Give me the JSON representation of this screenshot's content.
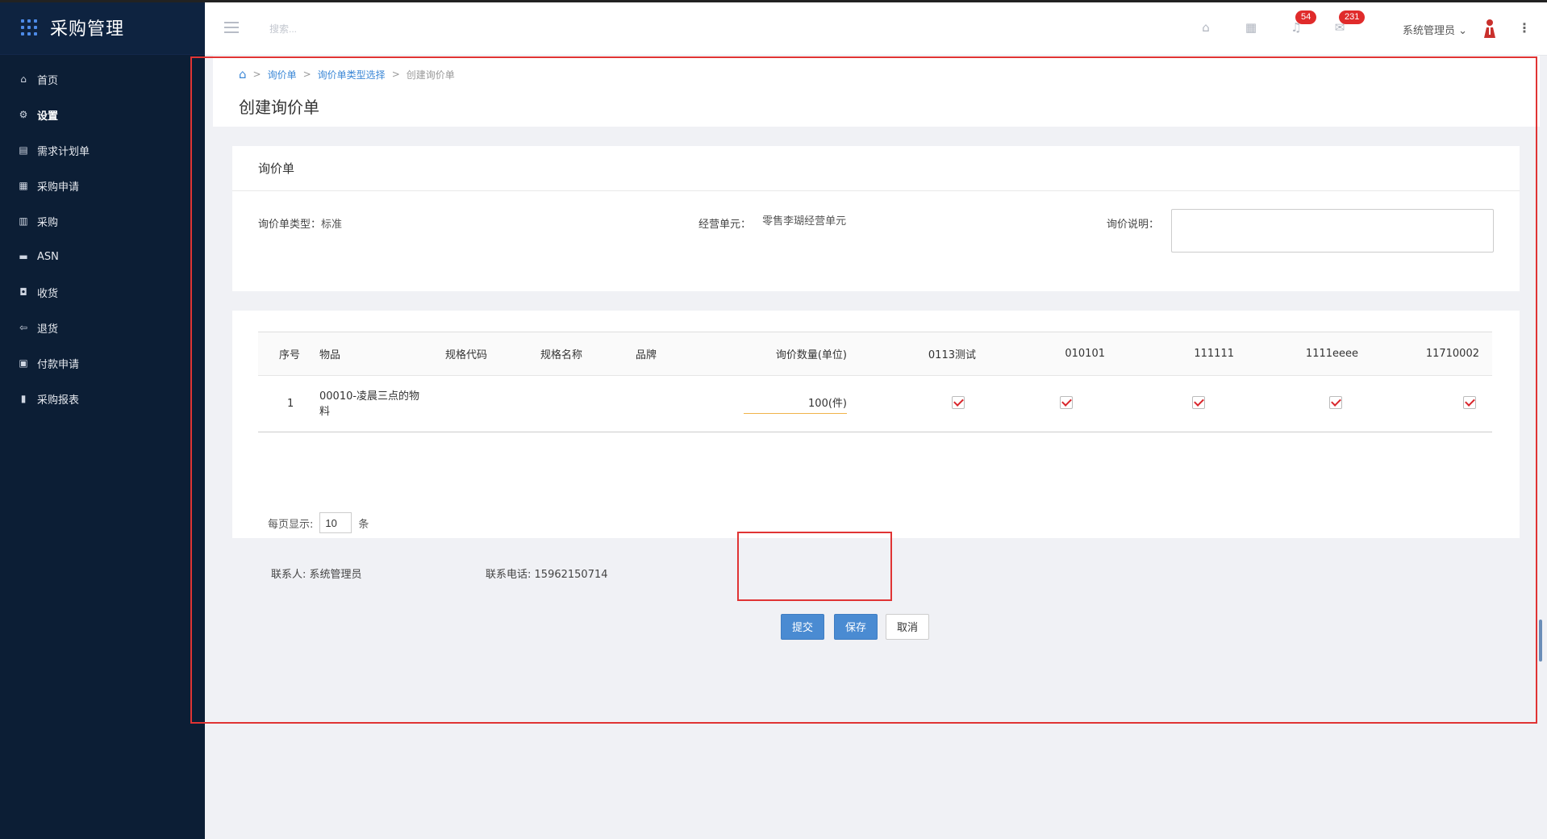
{
  "app": {
    "title": "采购管理"
  },
  "sidebar": {
    "items": [
      {
        "label": "首页",
        "icon": "home-icon"
      },
      {
        "label": "设置",
        "icon": "gear-icon"
      },
      {
        "label": "需求计划单",
        "icon": "plan-icon"
      },
      {
        "label": "采购申请",
        "icon": "request-icon"
      },
      {
        "label": "采购",
        "icon": "purchase-icon"
      },
      {
        "label": "ASN",
        "icon": "truck-icon"
      },
      {
        "label": "收货",
        "icon": "inbox-icon"
      },
      {
        "label": "退货",
        "icon": "return-icon"
      },
      {
        "label": "付款申请",
        "icon": "payment-icon"
      },
      {
        "label": "采购报表",
        "icon": "chart-icon"
      }
    ],
    "active_index": 1
  },
  "header": {
    "search_placeholder": "搜索...",
    "notifications_count": "54",
    "messages_count": "231",
    "user_name": "系统管理员"
  },
  "breadcrumb": {
    "items": [
      "询价单",
      "询价单类型选择"
    ],
    "current": "创建询价单"
  },
  "page": {
    "title": "创建询价单"
  },
  "form": {
    "section_title": "询价单",
    "type_label": "询价单类型：",
    "type_value": "标准",
    "unit_label": "经营单元：",
    "unit_value": "零售李瑚经营单元",
    "remark_label": "询价说明："
  },
  "table": {
    "headers": [
      "序号",
      "物品",
      "规格代码",
      "规格名称",
      "品牌",
      "询价数量(单位)",
      "0113测试",
      "010101",
      "111111",
      "1111eeee",
      "11710002"
    ],
    "rows": [
      {
        "index": "1",
        "item": "00010-凌晨三点的物料",
        "spec_code": "",
        "spec_name": "",
        "brand": "",
        "quantity": "100(件)",
        "suppliers_checked": [
          true,
          true,
          true,
          true,
          true
        ]
      }
    ]
  },
  "pager": {
    "label": "每页显示:",
    "size": "10",
    "unit": "条"
  },
  "contact": {
    "person_label": "联系人:",
    "person_value": "系统管理员",
    "phone_label": "联系电话:",
    "phone_value": "15962150714"
  },
  "actions": {
    "submit": "提交",
    "save": "保存",
    "cancel": "取消"
  },
  "colors": {
    "sidebar": "#0c1e35",
    "primary": "#4a8bd2",
    "highlight": "#e03434"
  }
}
